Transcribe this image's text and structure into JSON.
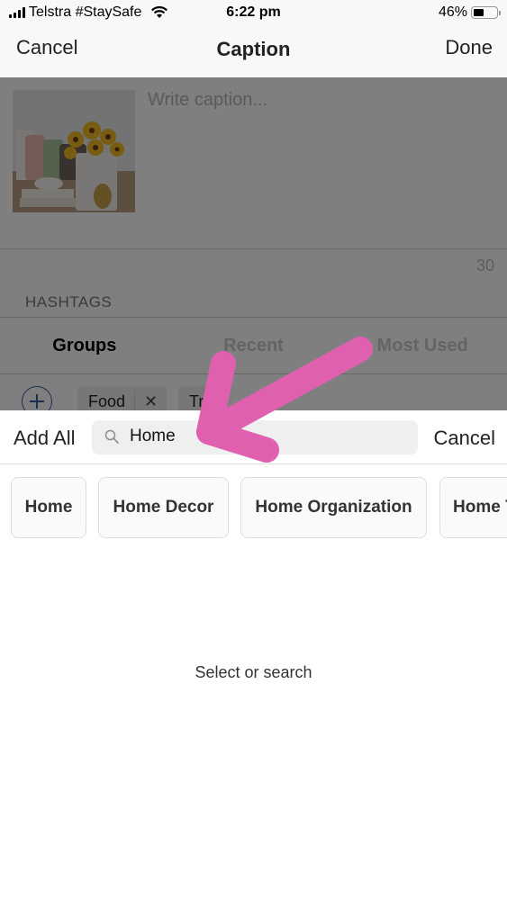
{
  "status_bar": {
    "carrier": "Telstra #StaySafe",
    "time": "6:22 pm",
    "battery_percent_label": "46%",
    "battery_level": 0.46,
    "icons": [
      "signal-icon",
      "wifi-icon",
      "battery-icon"
    ]
  },
  "nav": {
    "cancel_label": "Cancel",
    "title": "Caption",
    "done_label": "Done"
  },
  "caption": {
    "placeholder": "Write caption...",
    "thumbnail": "photo of sunflowers in a vase with cushions, teacup, books and gold pineapple",
    "remaining_count": "30"
  },
  "hashtags": {
    "section_label": "HASHTAGS",
    "tabs": [
      {
        "label": "Groups",
        "active": true
      },
      {
        "label": "Recent",
        "active": false
      },
      {
        "label": "Most Used",
        "active": false
      }
    ],
    "groups": [
      {
        "label": "Food",
        "remove_icon": "close-icon"
      },
      {
        "label": "Tr..."
      }
    ]
  },
  "search_sheet": {
    "add_all_label": "Add All",
    "search_value": "Home",
    "cancel_label": "Cancel",
    "suggestions": [
      "Home",
      "Home Decor",
      "Home Organization",
      "Home T..."
    ],
    "empty_message": "Select or search"
  },
  "annotation": {
    "type": "arrow",
    "color": "#e060b0",
    "points_to": "search-input"
  }
}
